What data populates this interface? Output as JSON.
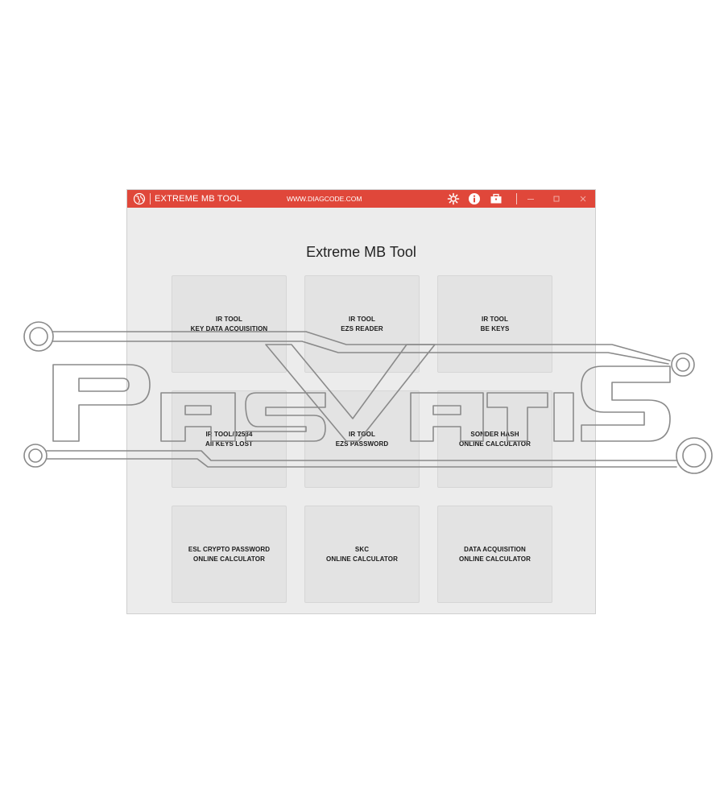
{
  "window": {
    "title": "EXTREME MB TOOL",
    "url": "WWW.DIAGCODE.COM",
    "accent_color": "#e0473a"
  },
  "toolbar_icons": [
    "gear-icon",
    "info-icon",
    "briefcase-icon"
  ],
  "window_controls": [
    "minimize-icon",
    "maximize-icon",
    "close-icon"
  ],
  "main": {
    "heading": "Extreme MB Tool",
    "tiles": [
      {
        "line1": "IR TOOL",
        "line2": "KEY DATA ACQUISITION"
      },
      {
        "line1": "IR TOOL",
        "line2": "EZS READER"
      },
      {
        "line1": "IR TOOL",
        "line2": "BE KEYS"
      },
      {
        "line1": "IR TOOL/J2534",
        "line2": "All KEYS LOST"
      },
      {
        "line1": "IR TOOL",
        "line2": "EZS PASSWORD"
      },
      {
        "line1": "SONDER HASH",
        "line2": "ONLINE CALCULATOR"
      },
      {
        "line1": "ESL CRYPTO PASSWORD",
        "line2": "ONLINE CALCULATOR"
      },
      {
        "line1": "SKC",
        "line2": "ONLINE CALCULATOR"
      },
      {
        "line1": "DATA ACQUISITION",
        "line2": "ONLINE CALCULATOR"
      }
    ]
  },
  "watermark": {
    "brand_name": "PASVATIS"
  }
}
